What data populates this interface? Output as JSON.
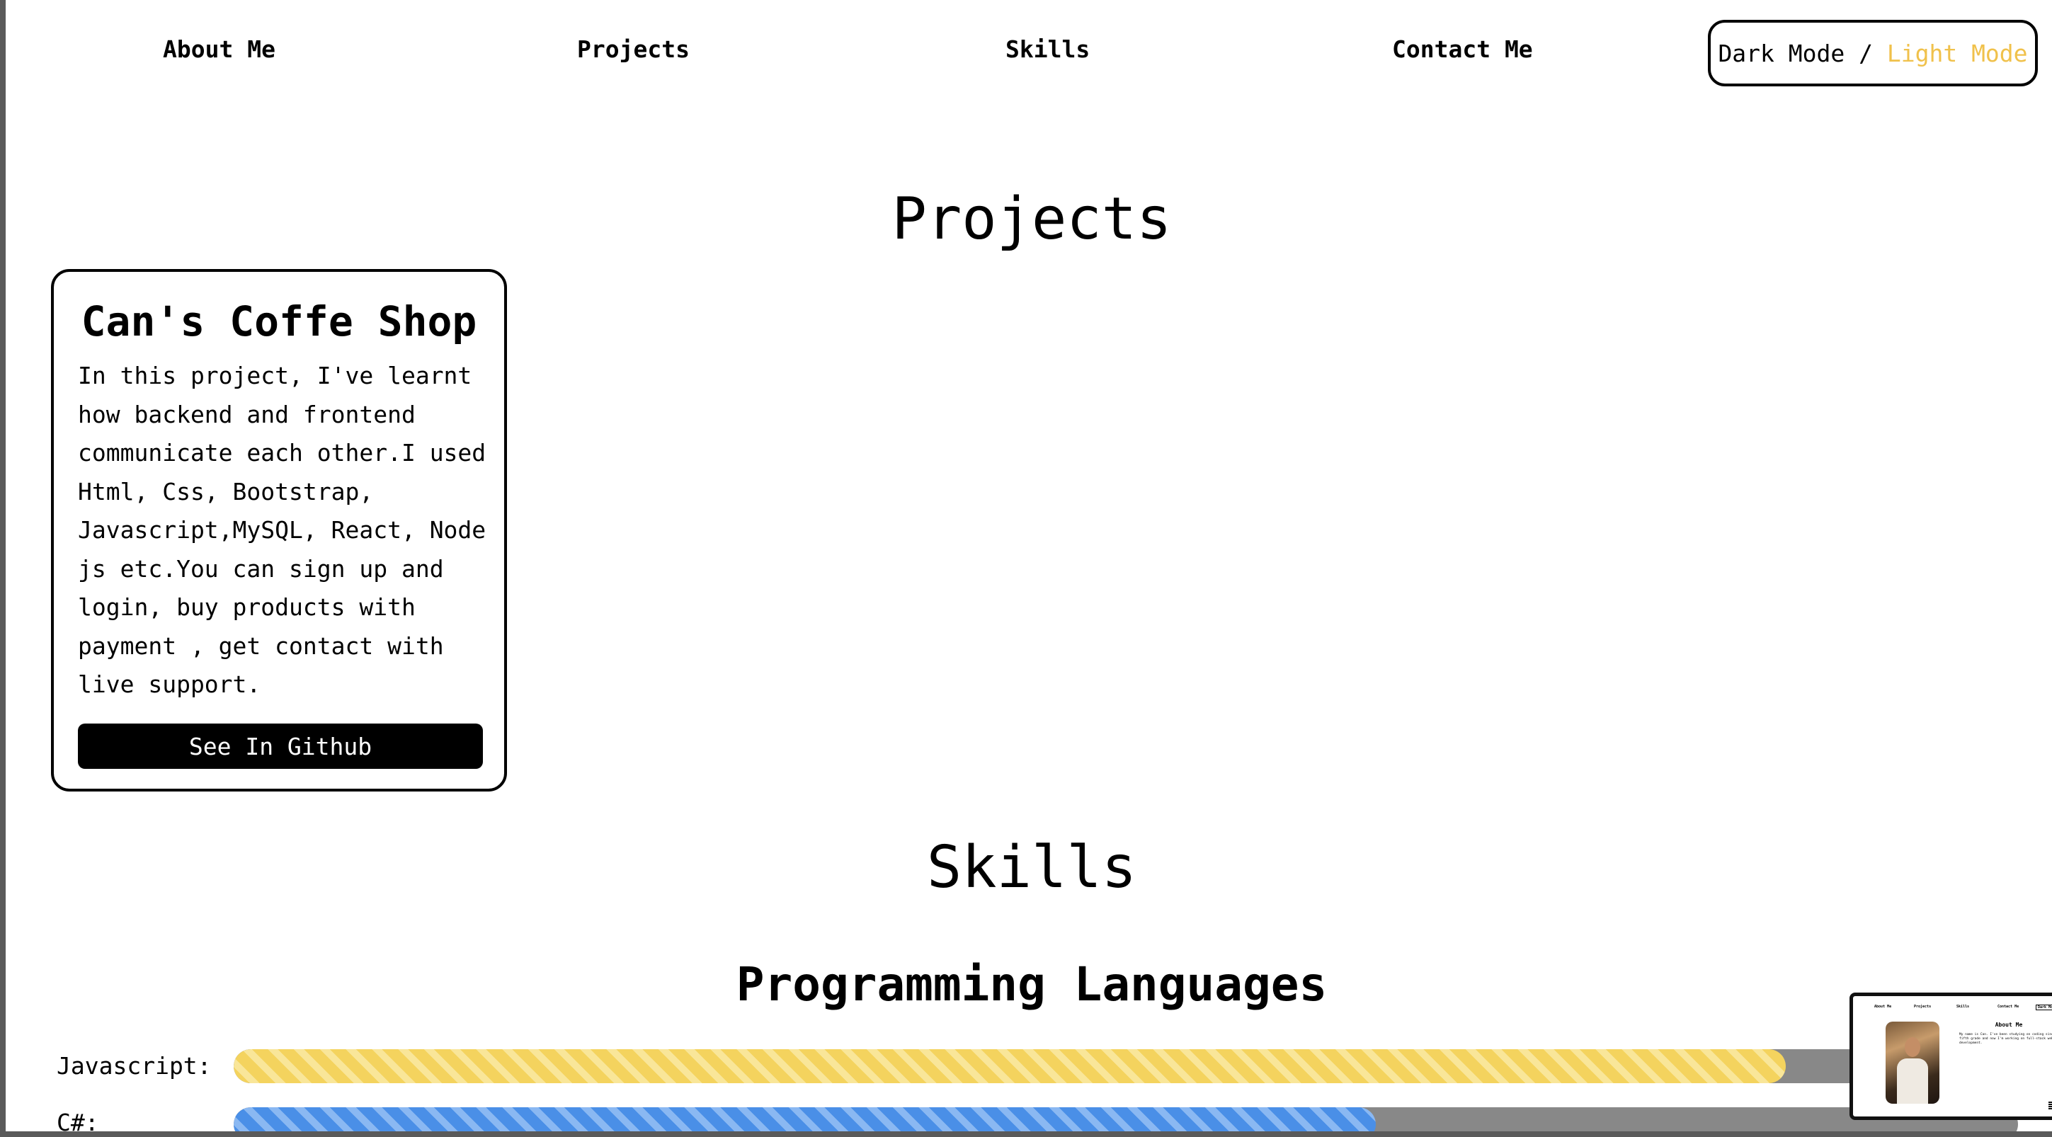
{
  "nav": {
    "about": "About Me",
    "projects": "Projects",
    "skills": "Skills",
    "contact": "Contact Me",
    "mode_dark": "Dark Mode",
    "mode_sep": " / ",
    "mode_light": "Light Mode"
  },
  "colors": {
    "accent_light_mode": "#f0c14b",
    "javascript_bar": "#f4d35e",
    "csharp_bar": "#4a8fe7",
    "bar_track": "#888888"
  },
  "projects": {
    "title": "Projects",
    "cards": [
      {
        "title": "Can's Coffe Shop",
        "description": "In this project, I've learnt how backend and frontend communicate each other.I used Html, Css, Bootstrap, Javascript,MySQL, React, Node js etc.You can sign up and login, buy products with payment , get contact with live support.",
        "button": "See In Github"
      }
    ]
  },
  "skills": {
    "title": "Skills",
    "subtitle": "Programming Languages",
    "items": [
      {
        "label": "Javascript:",
        "level": 0.87,
        "color": "yellow"
      },
      {
        "label": "C#:",
        "level": 0.64,
        "color": "blue"
      }
    ]
  },
  "thumbnail": {
    "nav": [
      "About Me",
      "Projects",
      "Skills",
      "Contact Me",
      "Dark Mode"
    ],
    "title": "About Me",
    "text": "My name is Can. I've been studying on coding since fifth grade and now I'm working on full-stack web development."
  }
}
